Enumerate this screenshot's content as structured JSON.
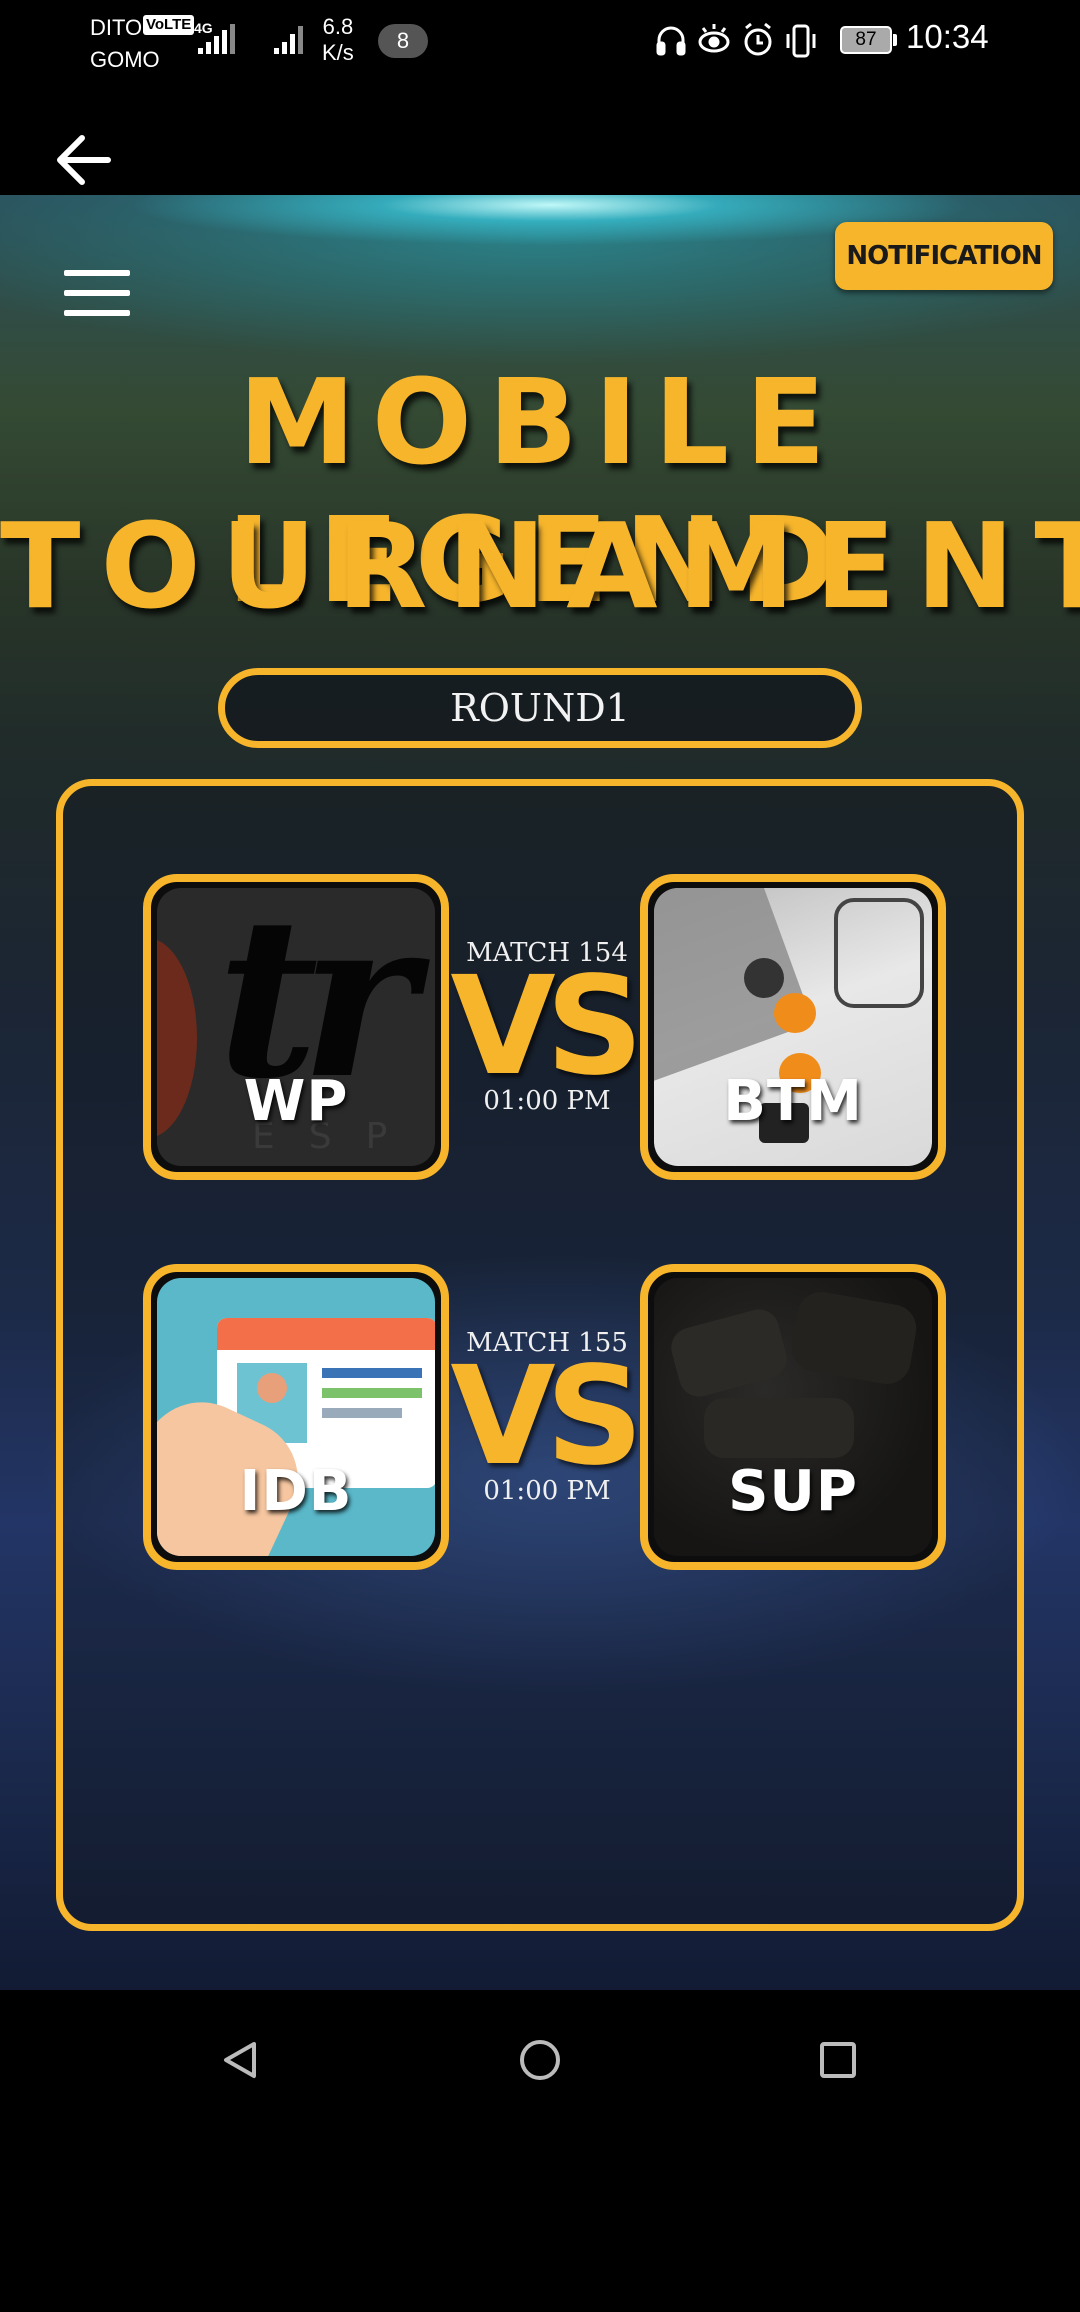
{
  "status_bar": {
    "carrier_1": "DITO",
    "carrier_2": "GOMO",
    "volte": "VoLTE",
    "network": "4G",
    "speed_value": "6.8",
    "speed_unit": "K/s",
    "notification_count": "8",
    "battery": "87",
    "time": "10:34",
    "icons": [
      "headset-icon",
      "eye-comfort-icon",
      "alarm-icon",
      "vibrate-icon"
    ]
  },
  "app_bar": {
    "back_icon": "arrow-left-icon"
  },
  "header": {
    "menu_icon": "hamburger-menu-icon",
    "notification_label": "NOTIFICATION"
  },
  "title": {
    "line1": "MOBILE LEGEND",
    "line2": "TOURNAMENT"
  },
  "round": {
    "label": "ROUND1"
  },
  "matches": [
    {
      "match_label": "MATCH 154",
      "vs_label": "VS",
      "time": "01:00 PM",
      "team_a": {
        "name": "WP"
      },
      "team_b": {
        "name": "BTM"
      }
    },
    {
      "match_label": "MATCH 155",
      "vs_label": "VS",
      "time": "01:00 PM",
      "team_a": {
        "name": "IDB"
      },
      "team_b": {
        "name": "SUP"
      }
    }
  ],
  "nav_bar": {
    "back": "triangle-back-icon",
    "home": "circle-home-icon",
    "recents": "square-recents-icon"
  },
  "colors": {
    "accent": "#f7b52c",
    "background_top": "#2b4f5a",
    "background_bottom": "#1c2a48"
  }
}
